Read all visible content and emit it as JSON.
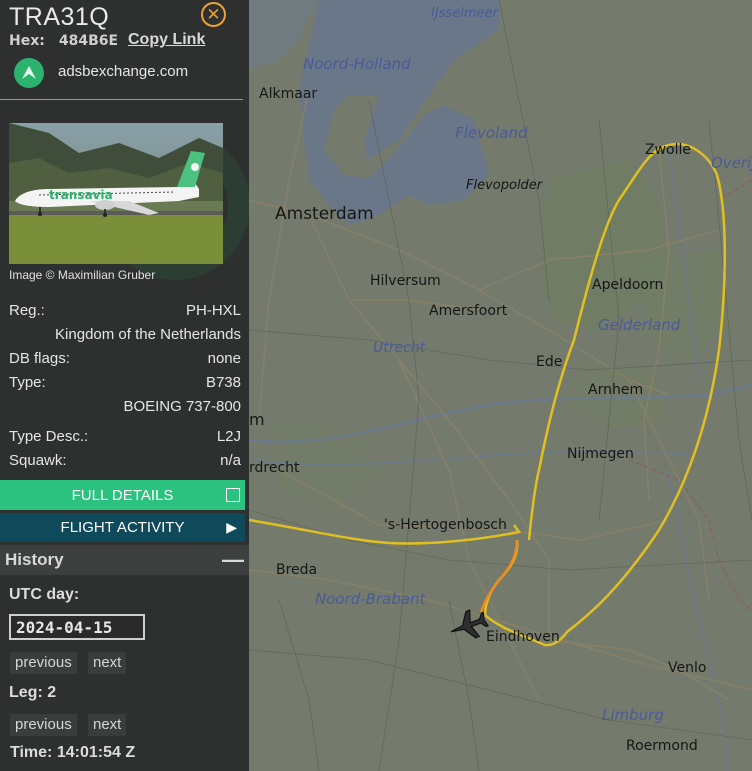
{
  "aircraft": {
    "callsign": "TRA31Q",
    "hex_label": "Hex:",
    "hex": "484B6E",
    "copy_link": "Copy Link",
    "source": "adsbexchange.com",
    "photo_livery": "transavia",
    "photo_caption": "Image © Maximilian Gruber"
  },
  "details": {
    "reg_label": "Reg.:",
    "reg": "PH-HXL",
    "country": "Kingdom of the Netherlands",
    "dbflags_label": "DB flags:",
    "dbflags": "none",
    "type_label": "Type:",
    "type": "B738",
    "type_full": "BOEING 737-800",
    "typedesc_label": "Type Desc.:",
    "typedesc": "L2J",
    "squawk_label": "Squawk:",
    "squawk": "n/a"
  },
  "buttons": {
    "full_details": "FULL DETAILS",
    "flight_activity": "FLIGHT ACTIVITY"
  },
  "history": {
    "title": "History",
    "collapse": "—",
    "utc_day_label": "UTC day:",
    "utc_day": "2024-04-15",
    "leg_label": "Leg: 2",
    "time_label": "Time: 14:01:54 Z",
    "previous": "previous",
    "next": "next"
  },
  "map": {
    "cities": [
      "Alkmaar",
      "Amsterdam",
      "Hilversum",
      "Amersfoort",
      "Utrecht",
      "Apeldoorn",
      "Ede",
      "Arnhem",
      "Nijmegen",
      "Zwolle",
      "'s-Hertogenbosch",
      "Breda",
      "Eindhoven",
      "Venlo",
      "Roermond",
      "Flevopolder",
      "rdrecht",
      "m"
    ],
    "regions": [
      "IJsselmeer",
      "Noord-Holland",
      "Flevoland",
      "Gelderland",
      "Noord-Brabant",
      "Limburg",
      "Overij"
    ],
    "colors": {
      "track_cruise": "#e0c020",
      "track_low": "#f08a1c",
      "map_bg": "#747b6d",
      "accent": "#2bc27f"
    }
  }
}
